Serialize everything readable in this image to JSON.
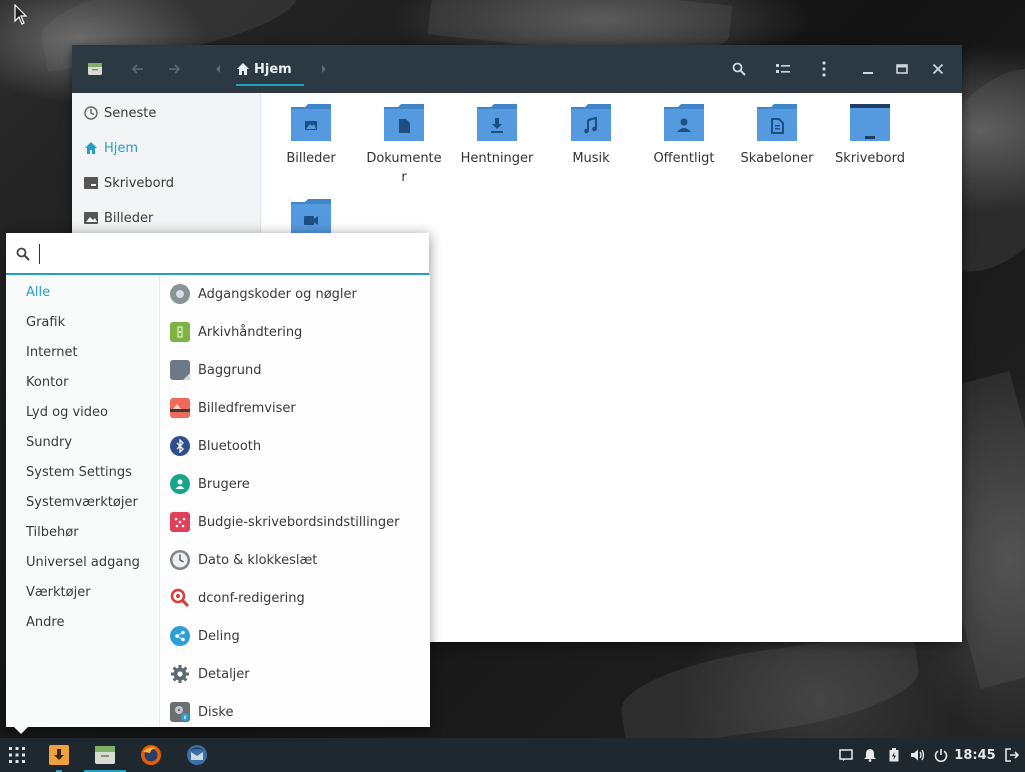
{
  "file_manager": {
    "breadcrumb": {
      "home_label": "Hjem"
    },
    "sidebar": [
      {
        "label": "Seneste",
        "icon": "clock-icon"
      },
      {
        "label": "Hjem",
        "icon": "home-icon",
        "active": true
      },
      {
        "label": "Skrivebord",
        "icon": "desktop-icon"
      },
      {
        "label": "Billeder",
        "icon": "image-icon"
      }
    ],
    "folders": [
      {
        "line1": "Billeder",
        "line2": "",
        "icon": "pictures-folder-icon"
      },
      {
        "line1": "Dokumente",
        "line2": "r",
        "icon": "documents-folder-icon"
      },
      {
        "line1": "Hentninger",
        "line2": "",
        "icon": "downloads-folder-icon"
      },
      {
        "line1": "Musik",
        "line2": "",
        "icon": "music-folder-icon"
      },
      {
        "line1": "Offentligt",
        "line2": "",
        "icon": "public-folder-icon"
      },
      {
        "line1": "Skabeloner",
        "line2": "",
        "icon": "templates-folder-icon"
      },
      {
        "line1": "Skrivebord",
        "line2": "",
        "icon": "desktop-folder-icon"
      },
      {
        "line1": "",
        "line2": "",
        "icon": "videos-folder-icon"
      }
    ]
  },
  "menu": {
    "search": {
      "value": ""
    },
    "categories": [
      {
        "label": "Alle",
        "active": true
      },
      {
        "label": "Grafik"
      },
      {
        "label": "Internet"
      },
      {
        "label": "Kontor"
      },
      {
        "label": "Lyd og video"
      },
      {
        "label": "Sundry"
      },
      {
        "label": "System Settings"
      },
      {
        "label": "Systemværktøjer"
      },
      {
        "label": "Tilbehør"
      },
      {
        "label": "Universel adgang"
      },
      {
        "label": "Værktøjer"
      },
      {
        "label": "Andre"
      }
    ],
    "apps": [
      {
        "label": "Adgangskoder og nøgler",
        "icon": "passwords-keys-icon",
        "color": "#8a9197"
      },
      {
        "label": "Arkivhåndtering",
        "icon": "archive-manager-icon",
        "color": "#7cb342"
      },
      {
        "label": "Baggrund",
        "icon": "wallpaper-icon",
        "color": "#6b7a86"
      },
      {
        "label": "Billedfremviser",
        "icon": "image-viewer-icon",
        "color": "#ef6a5a"
      },
      {
        "label": "Bluetooth",
        "icon": "bluetooth-icon",
        "color": "#2e4e8f"
      },
      {
        "label": "Brugere",
        "icon": "users-icon",
        "color": "#17a589"
      },
      {
        "label": "Budgie-skrivebordsindstillinger",
        "icon": "budgie-settings-icon",
        "color": "#e0405a"
      },
      {
        "label": "Dato & klokkeslæt",
        "icon": "clock-icon",
        "color": "#7d858c"
      },
      {
        "label": "dconf-redigering",
        "icon": "dconf-editor-icon",
        "color": "#d83a3a"
      },
      {
        "label": "Deling",
        "icon": "sharing-icon",
        "color": "#2a9fd8"
      },
      {
        "label": "Detaljer",
        "icon": "gear-icon",
        "color": "#5e6a73"
      },
      {
        "label": "Diske",
        "icon": "disks-icon",
        "color": "#6b6f73"
      }
    ]
  },
  "taskbar": {
    "clock": "18:45",
    "apps": [
      {
        "name": "downloads-app-icon"
      },
      {
        "name": "file-manager-app-icon"
      },
      {
        "name": "firefox-app-icon"
      },
      {
        "name": "thunderbird-app-icon"
      }
    ]
  }
}
